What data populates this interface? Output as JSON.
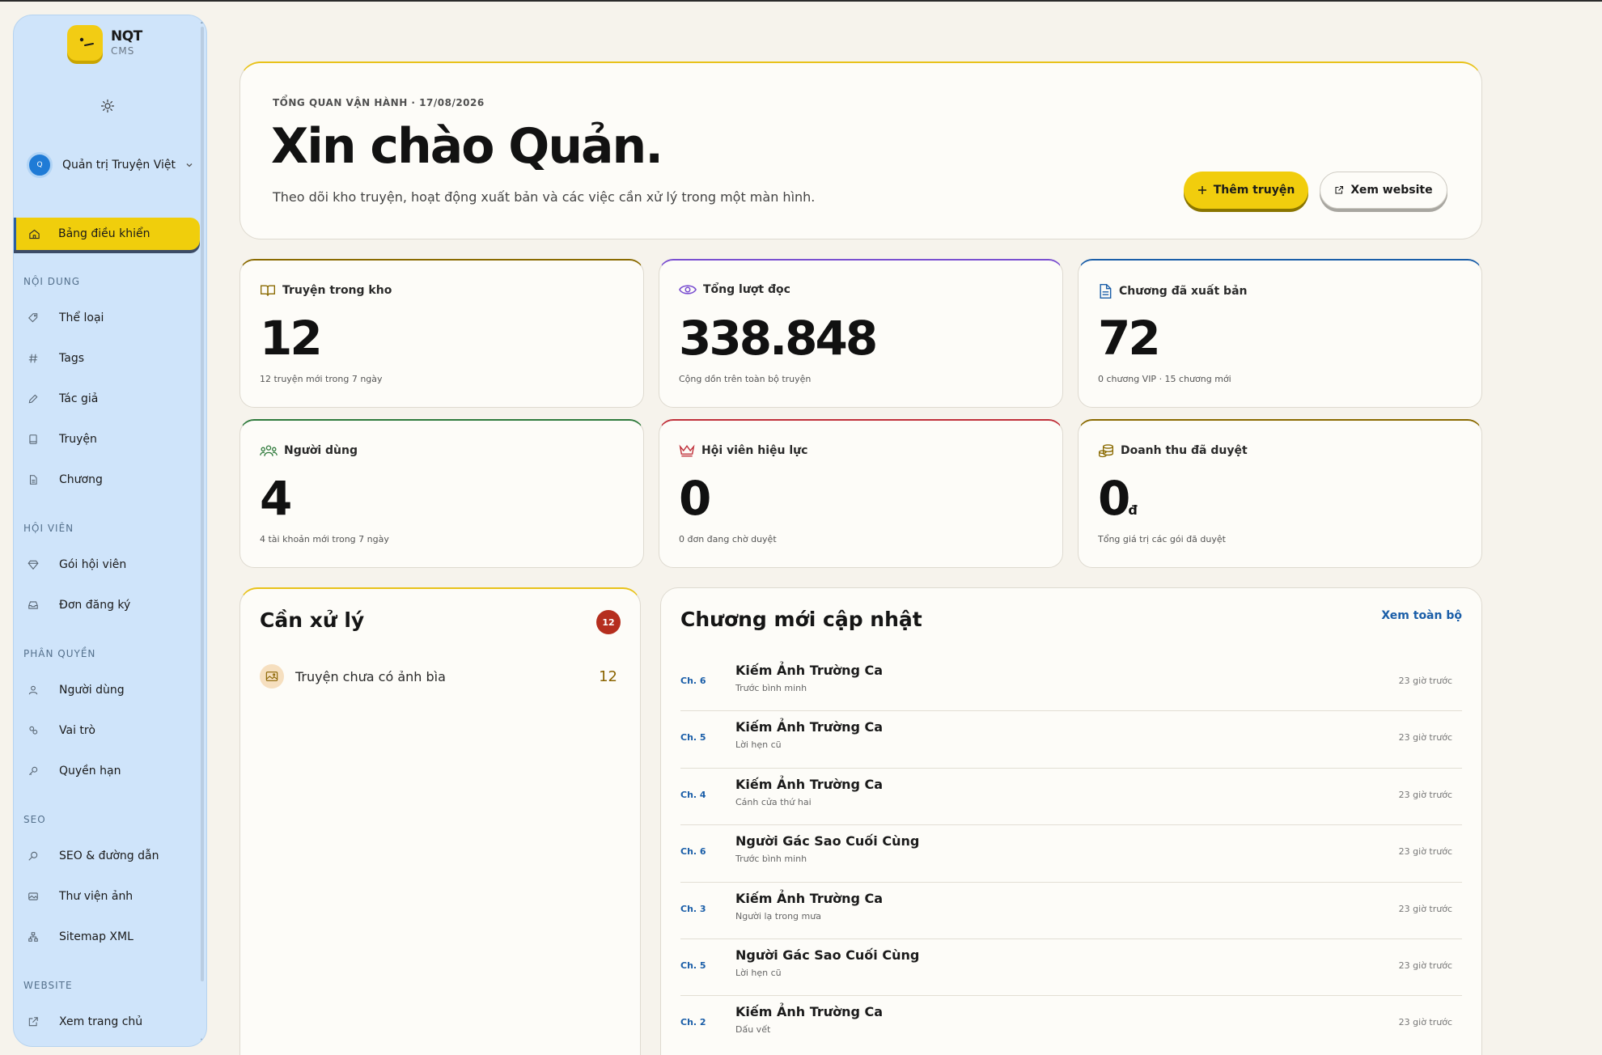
{
  "brand": {
    "title": "NQT",
    "subtitle": "CMS"
  },
  "org": {
    "avatar_letter": "Q",
    "name": "Quản trị Truyện Việt"
  },
  "nav": {
    "active": {
      "label": "Bảng điều khiển",
      "icon": "home-icon"
    },
    "sections": [
      {
        "title": "NỘI DUNG",
        "items": [
          {
            "label": "Thể loại",
            "icon": "tag-icon"
          },
          {
            "label": "Tags",
            "icon": "hash-icon"
          },
          {
            "label": "Tác giả",
            "icon": "pen-icon"
          },
          {
            "label": "Truyện",
            "icon": "book-icon"
          },
          {
            "label": "Chương",
            "icon": "document-icon"
          }
        ]
      },
      {
        "title": "HỘI VIÊN",
        "items": [
          {
            "label": "Gói hội viên",
            "icon": "diamond-icon"
          },
          {
            "label": "Đơn đăng ký",
            "icon": "inbox-icon"
          }
        ]
      },
      {
        "title": "PHÂN QUYỀN",
        "items": [
          {
            "label": "Người dùng",
            "icon": "user-icon"
          },
          {
            "label": "Vai trò",
            "icon": "roles-icon"
          },
          {
            "label": "Quyền hạn",
            "icon": "key-icon"
          }
        ]
      },
      {
        "title": "SEO",
        "items": [
          {
            "label": "SEO & đường dẫn",
            "icon": "search-icon"
          },
          {
            "label": "Thư viện ảnh",
            "icon": "image-library-icon"
          },
          {
            "label": "Sitemap XML",
            "icon": "sitemap-icon"
          }
        ]
      },
      {
        "title": "WEBSITE",
        "items": [
          {
            "label": "Xem trang chủ",
            "icon": "external-link-icon"
          }
        ]
      }
    ]
  },
  "hero": {
    "kicker": "TỔNG QUAN VẬN HÀNH · 17/08/2026",
    "title": "Xin chào Quản.",
    "subtitle": "Theo dõi kho truyện, hoạt động xuất bản và các việc cần xử lý trong một màn hình.",
    "add_button": "Thêm truyện",
    "view_site_button": "Xem website"
  },
  "stats": [
    {
      "label": "Truyện trong kho",
      "value": "12",
      "unit": "",
      "note": "12 truyện mới trong 7 ngày",
      "icon": "book-open-icon",
      "color": "#8a6a00"
    },
    {
      "label": "Tổng lượt đọc",
      "value": "338.848",
      "unit": "",
      "note": "Cộng dồn trên toàn bộ truyện",
      "icon": "eye-icon",
      "color": "#7a4fd0"
    },
    {
      "label": "Chương đã xuất bản",
      "value": "72",
      "unit": "",
      "note": "0 chương VIP · 15 chương mới",
      "icon": "document-icon",
      "color": "#1a5ea8"
    },
    {
      "label": "Người dùng",
      "value": "4",
      "unit": "",
      "note": "4 tài khoản mới trong 7 ngày",
      "icon": "users-icon",
      "color": "#2f7a3c"
    },
    {
      "label": "Hội viên hiệu lực",
      "value": "0",
      "unit": "",
      "note": "0 đơn đang chờ duyệt",
      "icon": "crown-icon",
      "color": "#c0303a"
    },
    {
      "label": "Doanh thu đã duyệt",
      "value": "0",
      "unit": "đ",
      "note": "Tổng giá trị các gói đã duyệt",
      "icon": "coins-icon",
      "color": "#8a6a00"
    }
  ],
  "todo": {
    "title": "Cần xử lý",
    "badge": "12",
    "items": [
      {
        "label": "Truyện chưa có ảnh bìa",
        "count": "12",
        "icon": "image-icon"
      }
    ]
  },
  "chapters": {
    "title": "Chương mới cập nhật",
    "view_all": "Xem toàn bộ",
    "rows": [
      {
        "num": "Ch. 6",
        "story": "Kiếm Ảnh Trường Ca",
        "title": "Trước bình minh",
        "time": "23 giờ trước"
      },
      {
        "num": "Ch. 5",
        "story": "Kiếm Ảnh Trường Ca",
        "title": "Lời hẹn cũ",
        "time": "23 giờ trước"
      },
      {
        "num": "Ch. 4",
        "story": "Kiếm Ảnh Trường Ca",
        "title": "Cánh cửa thứ hai",
        "time": "23 giờ trước"
      },
      {
        "num": "Ch. 6",
        "story": "Người Gác Sao Cuối Cùng",
        "title": "Trước bình minh",
        "time": "23 giờ trước"
      },
      {
        "num": "Ch. 3",
        "story": "Kiếm Ảnh Trường Ca",
        "title": "Người lạ trong mưa",
        "time": "23 giờ trước"
      },
      {
        "num": "Ch. 5",
        "story": "Người Gác Sao Cuối Cùng",
        "title": "Lời hẹn cũ",
        "time": "23 giờ trước"
      },
      {
        "num": "Ch. 2",
        "story": "Kiếm Ảnh Trường Ca",
        "title": "Dấu vết",
        "time": "23 giờ trước"
      }
    ]
  }
}
